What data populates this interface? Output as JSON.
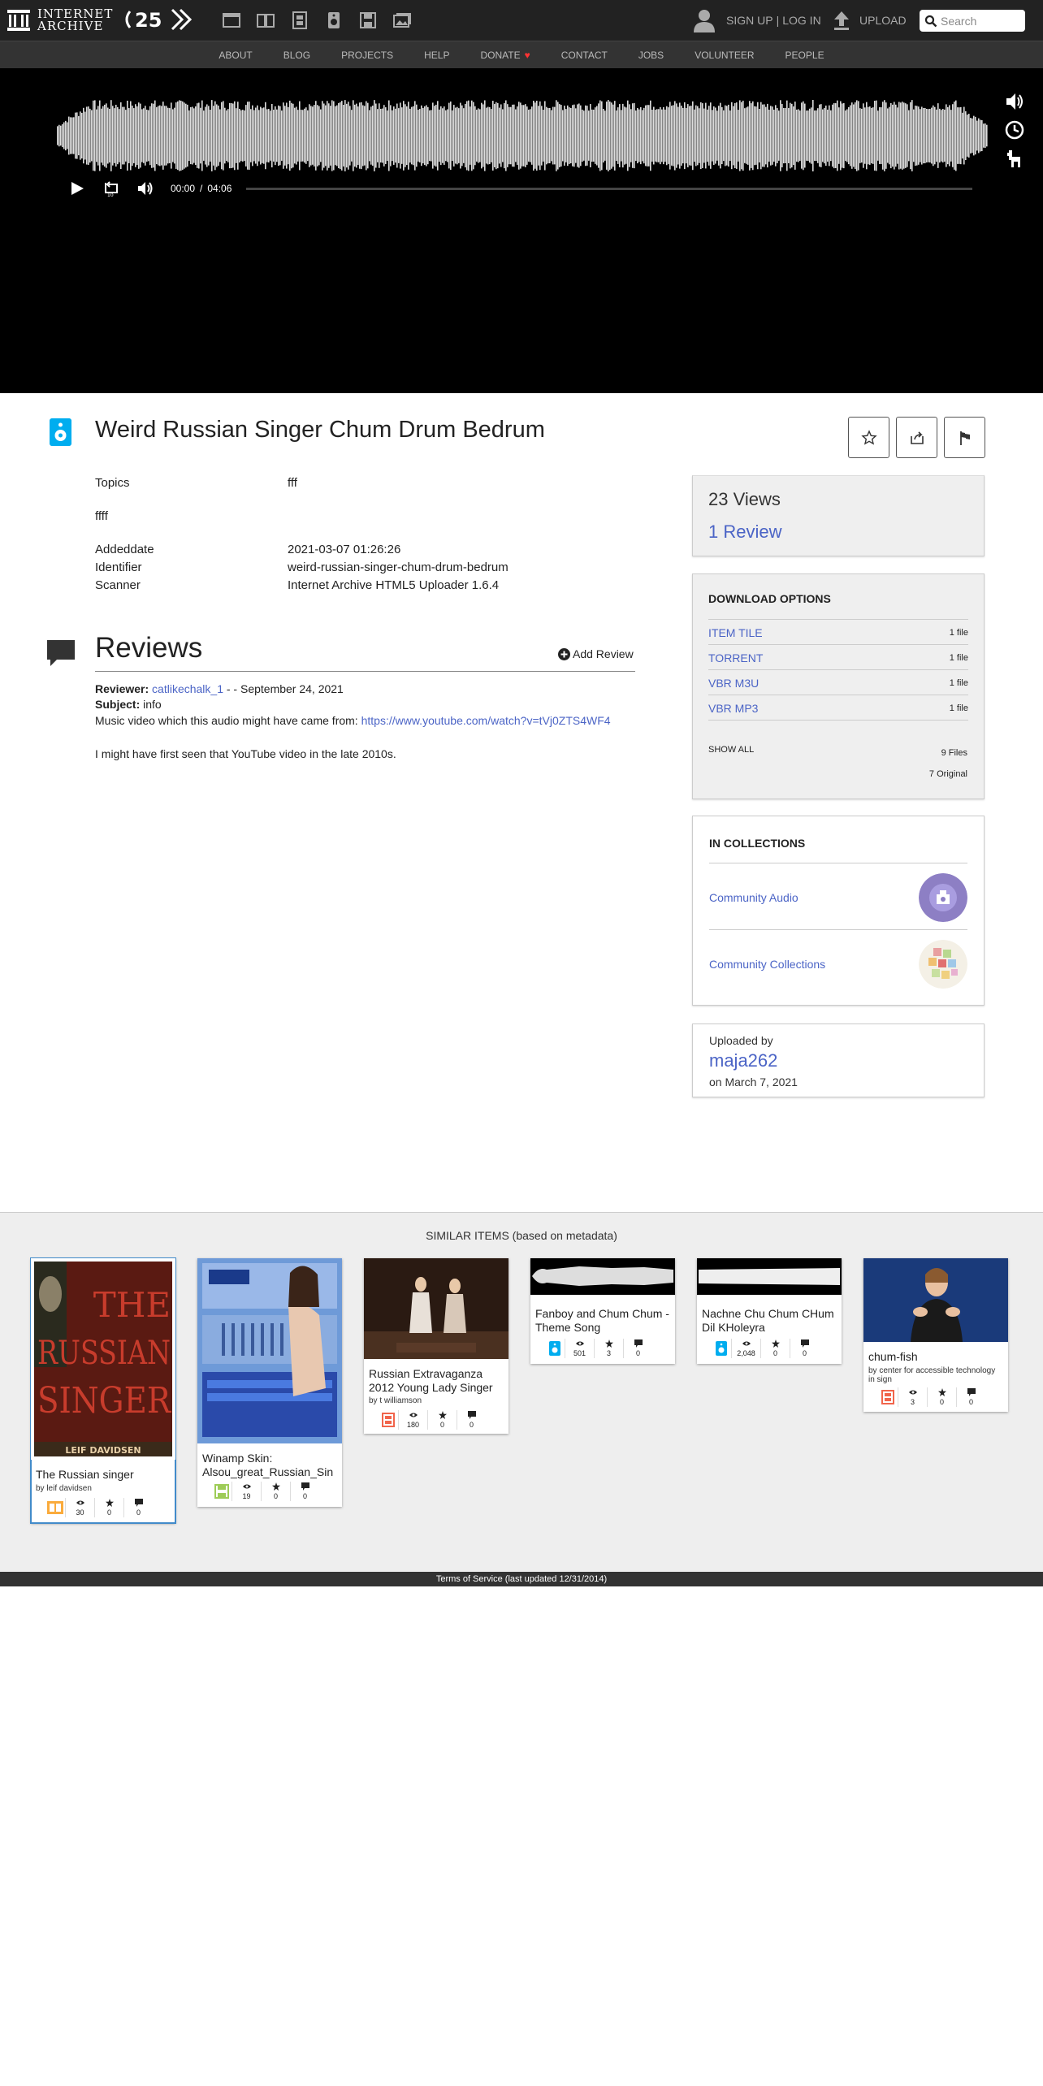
{
  "header": {
    "logo_line1": "INTERNET",
    "logo_line2": "ARCHIVE",
    "media_icons": [
      "web-icon",
      "texts-icon",
      "video-icon",
      "audio-icon",
      "software-icon",
      "images-icon"
    ],
    "signup_label": "SIGN UP",
    "separator": "|",
    "login_label": "LOG IN",
    "upload_label": "UPLOAD",
    "search_placeholder": "Search"
  },
  "nav": {
    "items": [
      "ABOUT",
      "BLOG",
      "PROJECTS",
      "HELP",
      "DONATE",
      "CONTACT",
      "JOBS",
      "VOLUNTEER",
      "PEOPLE"
    ],
    "donate_heart": "♥"
  },
  "player": {
    "current_time": "00:00",
    "time_separator": "/",
    "duration": "04:06",
    "progress": 0
  },
  "item": {
    "title": "Weird Russian Singer Chum Drum Bedrum",
    "media_type": "audio",
    "metadata": [
      {
        "key": "Topics",
        "value": "fff",
        "link": true
      },
      {
        "key": "Addeddate",
        "value": "2021-03-07 01:26:26"
      },
      {
        "key": "Identifier",
        "value": "weird-russian-singer-chum-drum-bedrum"
      },
      {
        "key": "Scanner",
        "value": "Internet Archive HTML5 Uploader 1.6.4"
      }
    ],
    "description": "ffff"
  },
  "reviews": {
    "title": "Reviews",
    "add_label": "Add Review",
    "review": {
      "reviewer_label": "Reviewer:",
      "reviewer": "catlikechalk_1",
      "date": "- - September 24, 2021",
      "subject_label": "Subject:",
      "subject": "info",
      "body_prefix": "Music video which this audio might have came from:",
      "body_link": "https://www.youtube.com/watch?v=tVj0ZTS4WF4",
      "body_2": "I might have first seen that YouTube video in the late 2010s."
    }
  },
  "stats": {
    "views": "23 Views",
    "reviews": "1 Review"
  },
  "downloads": {
    "title": "DOWNLOAD OPTIONS",
    "formats": [
      {
        "name": "ITEM TILE",
        "count": "1 file"
      },
      {
        "name": "TORRENT",
        "count": "1 file"
      },
      {
        "name": "VBR M3U",
        "count": "1 file"
      },
      {
        "name": "VBR MP3",
        "count": "1 file"
      }
    ],
    "show_all": "SHOW ALL",
    "files_count": "9 Files",
    "original_count": "7 Original"
  },
  "collections": {
    "title": "IN COLLECTIONS",
    "items": [
      {
        "name": "Community Audio"
      },
      {
        "name": "Community Collections"
      }
    ]
  },
  "uploader": {
    "label": "Uploaded by",
    "name": "maja262",
    "date": "on March 7, 2021"
  },
  "similar": {
    "title": "SIMILAR ITEMS (based on metadata)",
    "items": [
      {
        "title": "The Russian singer",
        "by": "by leif davidsen",
        "type": "texts",
        "views": "30",
        "favs": "0",
        "reviews": "0",
        "thumb_text_1": "THE",
        "thumb_text_2": "RUSSIAN",
        "thumb_text_3": "SINGER",
        "thumb_text_4": "LEIF DAVIDSEN"
      },
      {
        "title": "Winamp Skin: Alsou_great_Russian_Sin",
        "by": "",
        "type": "software",
        "views": "19",
        "favs": "0",
        "reviews": "0"
      },
      {
        "title": "Russian Extravaganza 2012 Young Lady Singer",
        "by": "by t williamson",
        "type": "movies",
        "views": "180",
        "favs": "0",
        "reviews": "0"
      },
      {
        "title": "Fanboy and Chum Chum - Theme Song",
        "by": "",
        "type": "audio",
        "views": "501",
        "favs": "3",
        "reviews": "0"
      },
      {
        "title": "Nachne Chu Chum CHum Dil KHoleyra",
        "by": "",
        "type": "audio",
        "views": "2,048",
        "favs": "0",
        "reviews": "0"
      },
      {
        "title": "chum-fish",
        "by": "by center for accessible technology in sign",
        "type": "movies",
        "views": "3",
        "favs": "0",
        "reviews": "0"
      }
    ]
  },
  "footer": {
    "text": "Terms of Service (last updated 12/31/2014)"
  },
  "colors": {
    "link": "#4b64c6",
    "audio_type": "#00adef",
    "texts_type": "#faab3c",
    "software_type": "#9ecc57",
    "movies_type": "#f1644b",
    "donate_heart": "#ff3333"
  }
}
